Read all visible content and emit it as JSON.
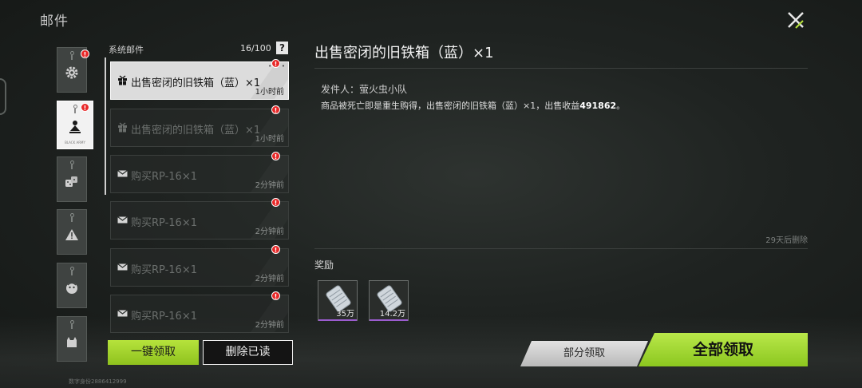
{
  "page": {
    "title": "邮件",
    "uid_text": "数字身份2886412999"
  },
  "categories": [
    {
      "name": "settings",
      "icon": "gear-icon",
      "badge": "!"
    },
    {
      "name": "personal",
      "icon": "person-icon",
      "badge": "!",
      "active": true,
      "tiny_text": "BLACK ARMY"
    },
    {
      "name": "dice",
      "icon": "dice-icon"
    },
    {
      "name": "warning",
      "icon": "warning-icon"
    },
    {
      "name": "character",
      "icon": "face-icon"
    },
    {
      "name": "pet",
      "icon": "creature-icon"
    }
  ],
  "list": {
    "header": "系统邮件",
    "count": "16/100",
    "help": "?",
    "items": [
      {
        "icon": "gift-icon",
        "title": "出售密闭的旧铁箱（蓝）×1",
        "time": "1小时前",
        "selected": true,
        "badge": "!"
      },
      {
        "icon": "gift-icon",
        "title": "出售密闭的旧铁箱（蓝）×1",
        "time": "1小时前",
        "badge": "!"
      },
      {
        "icon": "envelope-icon",
        "title": "购买RP-16×1",
        "time": "2分钟前",
        "badge": "!"
      },
      {
        "icon": "envelope-icon",
        "title": "购买RP-16×1",
        "time": "2分钟前",
        "badge": "!"
      },
      {
        "icon": "envelope-icon",
        "title": "购买RP-16×1",
        "time": "2分钟前",
        "badge": "!"
      },
      {
        "icon": "envelope-icon",
        "title": "购买RP-16×1",
        "time": "2分钟前",
        "badge": "!"
      }
    ],
    "claim_one": "一键领取",
    "delete_read": "删除已读"
  },
  "detail": {
    "title": "出售密闭的旧铁箱（蓝）×1",
    "sender_label": "发件人：",
    "sender_name": "萤火虫小队",
    "body_prefix": "商品被死亡即是重生购得，出售密闭的旧铁箱（蓝）×1，出售收益",
    "body_amount": "491862",
    "body_suffix": "。",
    "expire": "29天后删除",
    "rewards_label": "奖励",
    "rewards": [
      {
        "icon": "cash-bundle-icon",
        "qty": "35万",
        "rarity_color": "#9b5ccf"
      },
      {
        "icon": "cash-bundle-icon",
        "qty": "14.2万",
        "rarity_color": "#9b5ccf"
      }
    ]
  },
  "actions": {
    "partial": "部分领取",
    "all": "全部领取"
  }
}
